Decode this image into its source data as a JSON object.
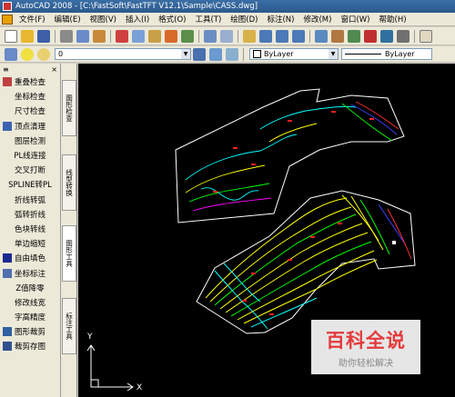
{
  "window": {
    "title": "AutoCAD 2008 - [C:\\FastSoft\\FastTFT V12.1\\Sample\\CASS.dwg]"
  },
  "menu": [
    "文件(F)",
    "编辑(E)",
    "视图(V)",
    "插入(I)",
    "格式(O)",
    "工具(T)",
    "绘图(D)",
    "标注(N)",
    "修改(M)",
    "窗口(W)",
    "帮助(H)"
  ],
  "layer": {
    "current": "0"
  },
  "properties": {
    "color": "ByLayer",
    "linetype": "ByLayer"
  },
  "sidebar": {
    "items": [
      {
        "label": "重叠检查",
        "icon": "overlap-check-icon"
      },
      {
        "label": "坐标检查",
        "icon": ""
      },
      {
        "label": "尺寸检查",
        "icon": ""
      },
      {
        "label": "顶点清理",
        "icon": "vertex-clean-icon"
      },
      {
        "label": "图层检测",
        "icon": ""
      },
      {
        "label": "PL线连接",
        "icon": ""
      },
      {
        "label": "交叉打断",
        "icon": ""
      },
      {
        "label": "SPLINE转PL",
        "icon": ""
      },
      {
        "label": "折线转弧",
        "icon": ""
      },
      {
        "label": "弧转折线",
        "icon": ""
      },
      {
        "label": "色块转线",
        "icon": ""
      },
      {
        "label": "单边缩短",
        "icon": ""
      },
      {
        "label": "自由填色",
        "icon": "fill-color-icon"
      },
      {
        "label": "坐标标注",
        "icon": "coordinate-label-icon"
      },
      {
        "label": "Z值降零",
        "icon": ""
      },
      {
        "label": "修改线宽",
        "icon": ""
      },
      {
        "label": "字高精度",
        "icon": ""
      },
      {
        "label": "图形裁剪",
        "icon": "clip-shape-icon"
      },
      {
        "label": "裁剪存图",
        "icon": "clip-save-icon"
      }
    ],
    "tabs": [
      "图形检查",
      "线型转换",
      "图形工具",
      "标注工具"
    ]
  },
  "watermark": {
    "main": "百科全说",
    "sub": "助你轻松解决"
  },
  "ucs": {
    "x": "X",
    "y": "Y"
  }
}
